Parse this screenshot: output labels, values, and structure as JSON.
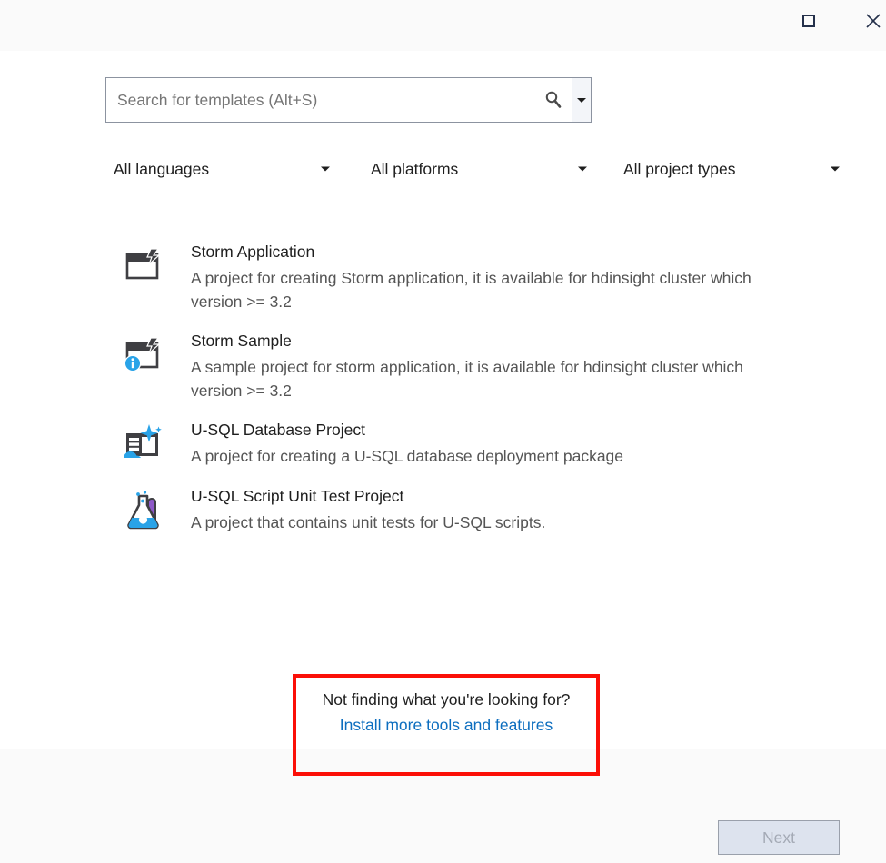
{
  "window": {
    "maximize_icon": "maximize-square-icon",
    "close_icon": "close-x-icon"
  },
  "search": {
    "placeholder": "Search for templates (Alt+S)",
    "value": "",
    "icon": "search-magnifier-icon",
    "dropdown_icon": "chevron-down-icon"
  },
  "filters": [
    {
      "label": "All languages",
      "icon": "chevron-down-icon"
    },
    {
      "label": "All platforms",
      "icon": "chevron-down-icon"
    },
    {
      "label": "All project types",
      "icon": "chevron-down-icon"
    }
  ],
  "templates": [
    {
      "title": "Storm Application",
      "description": "A project for creating Storm application, it is available for hdinsight cluster which version >= 3.2",
      "icon": "storm-application-icon"
    },
    {
      "title": "Storm Sample",
      "description": "A sample project for storm application, it is available for hdinsight cluster which version >= 3.2",
      "icon": "storm-sample-info-icon"
    },
    {
      "title": "U-SQL Database Project",
      "description": "A project for creating a U-SQL database deployment package",
      "icon": "usql-database-project-icon"
    },
    {
      "title": "U-SQL Script Unit Test Project",
      "description": "A project that contains unit tests for U-SQL scripts.",
      "icon": "usql-unit-test-flask-icon"
    }
  ],
  "not_finding": {
    "question": "Not finding what you're looking for?",
    "link": "Install more tools and features"
  },
  "footer": {
    "next_label": "Next"
  },
  "colors": {
    "accent_blue": "#0d6ebf",
    "icon_blue": "#29a3e8",
    "icon_dark": "#3f3f43",
    "annotation_red": "#fb0f07",
    "page_background": "#fafafa",
    "panel_background": "#ffffff"
  }
}
